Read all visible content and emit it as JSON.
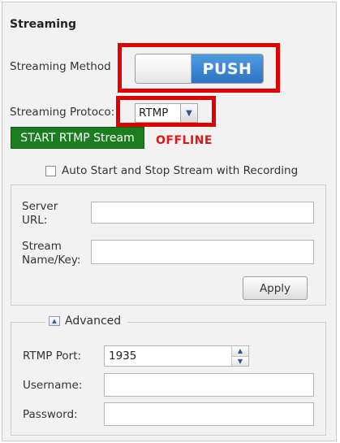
{
  "section_title": "Streaming",
  "streaming_method": {
    "label": "Streaming Method",
    "toggle_value": "PUSH"
  },
  "streaming_protocol": {
    "label": "Streaming Protoco:",
    "selected": "RTMP"
  },
  "start_button": "START RTMP Stream",
  "status": "OFFLINE",
  "auto_checkbox": {
    "label": "Auto Start and Stop Stream with Recording",
    "checked": false
  },
  "server": {
    "server_url_label_1": "Server",
    "server_url_label_2": "URL:",
    "server_url_value": "",
    "stream_key_label_1": "Stream",
    "stream_key_label_2": "Name/Key:",
    "stream_key_value": ""
  },
  "apply_button": "Apply",
  "advanced": {
    "legend": "Advanced",
    "rtmp_port_label": "RTMP Port:",
    "rtmp_port_value": "1935",
    "username_label": "Username:",
    "username_value": "",
    "password_label": "Password:",
    "password_value": ""
  },
  "colors": {
    "highlight": "#e00000",
    "toggle_on": "#2d74c4",
    "start_button": "#1a7d1e",
    "offline": "#e21414"
  },
  "icons": {
    "select_arrow": "chevron-down-icon",
    "advanced_toggle": "collapse-up-icon",
    "spinner_up": "arrow-up-icon",
    "spinner_down": "arrow-down-icon"
  }
}
